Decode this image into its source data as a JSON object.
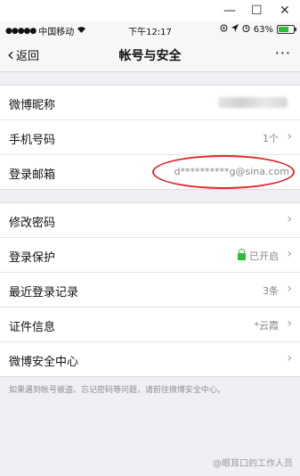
{
  "window_bar": {
    "minimize": "—",
    "maximize": "☐",
    "close": "✕"
  },
  "status": {
    "carrier": "中国移动",
    "time": "下午12:17",
    "battery": "63%"
  },
  "nav": {
    "back_label": "返回",
    "title": "帐号与安全",
    "more": "···"
  },
  "group1": [
    {
      "label": "微博昵称",
      "value": ""
    },
    {
      "label": "手机号码",
      "value": "1个"
    },
    {
      "label": "登录邮箱",
      "value": "d**********g@sina.com"
    }
  ],
  "group2": [
    {
      "label": "修改密码",
      "value": ""
    },
    {
      "label": "登录保护",
      "value": "已开启"
    },
    {
      "label": "最近登录记录",
      "value": "3条"
    },
    {
      "label": "证件信息",
      "value": "*云霞"
    },
    {
      "label": "微博安全中心",
      "value": ""
    }
  ],
  "footer_note": "如果遇到帐号被盗、忘记密码等问题，请前往微博安全中心。",
  "watermark": "@眼耳口的工作人员",
  "colors": {
    "accent_red": "#e3262a",
    "green": "#2dbe37"
  }
}
